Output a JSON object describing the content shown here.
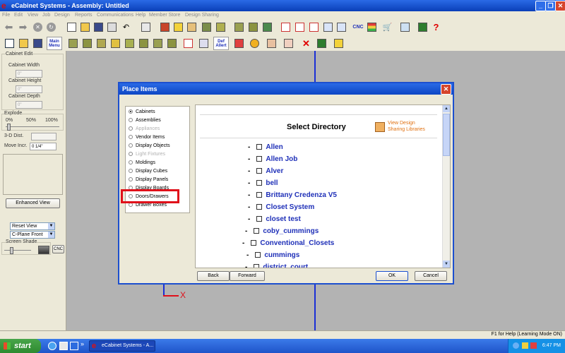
{
  "window": {
    "title": "eCabinet Systems - Assembly: Untitled",
    "minimize": "_",
    "maximize": "❐",
    "close": "✕"
  },
  "menu": [
    "File",
    "Edit",
    "View",
    "Job",
    "Design",
    "Reports",
    "Communications",
    "Help",
    "Member Store",
    "Design Sharing"
  ],
  "toolbar": {
    "main_label": "Main",
    "main_sublabel": "Menu",
    "cnc_label": "CNC",
    "help_glyph": "?",
    "def_label": "Def",
    "def_sublabel": "Allert"
  },
  "left_panel": {
    "section_title": "Cabinet Edit",
    "cabinet_width_label": "Cabinet Width",
    "cabinet_width_value": "0\"",
    "cabinet_height_label": "Cabinet Height",
    "cabinet_height_value": "0\"",
    "cabinet_depth_label": "Cabinet Depth",
    "cabinet_depth_value": "0\"",
    "explode_label": "Explode",
    "explode_ticks": [
      "0%",
      "50%",
      "100%"
    ],
    "dist_3d_label": "3-D Dist.",
    "move_incr_label": "Move Incr.",
    "move_incr_value": "0 1/4\"",
    "enhanced_view_button": "Enhanced View",
    "view_select": "Reset View",
    "plane_select": "C-Plane Front",
    "screen_shade_label": "Screen Shade",
    "cnc_button": "CNC"
  },
  "canvas": {
    "axis_x_label": "X"
  },
  "dialog": {
    "title": "Place Items",
    "close": "✕",
    "categories": [
      {
        "label": "Cabinets",
        "selected": true,
        "disabled": false
      },
      {
        "label": "Assemblies",
        "selected": false,
        "disabled": false
      },
      {
        "label": "Appliances",
        "selected": false,
        "disabled": true
      },
      {
        "label": "Vendor Items",
        "selected": false,
        "disabled": false
      },
      {
        "label": "Display Objects",
        "selected": false,
        "disabled": false
      },
      {
        "label": "Light Fixtures",
        "selected": false,
        "disabled": true
      },
      {
        "label": "Moldings",
        "selected": false,
        "disabled": false
      },
      {
        "label": "Display Cubes",
        "selected": false,
        "disabled": false
      },
      {
        "label": "Display Panels",
        "selected": false,
        "disabled": false
      },
      {
        "label": "Display Boards",
        "selected": false,
        "disabled": false
      },
      {
        "label": "Doors/Drawers",
        "selected": false,
        "disabled": false
      },
      {
        "label": "Drawer Boxes",
        "selected": false,
        "disabled": false
      }
    ],
    "heading": "Select Directory",
    "view_libraries_line1": "View Design",
    "view_libraries_line2": "Sharing Libraries",
    "directories": [
      {
        "name": "Allen",
        "indent": 0
      },
      {
        "name": "Allen Job",
        "indent": 0
      },
      {
        "name": "Alver",
        "indent": 0
      },
      {
        "name": "bell",
        "indent": 0
      },
      {
        "name": "Brittany Credenza V5",
        "indent": 0
      },
      {
        "name": "Closet System",
        "indent": 0
      },
      {
        "name": "closet test",
        "indent": 0
      },
      {
        "name": "coby_cummings",
        "indent": 1
      },
      {
        "name": "Conventional_Closets",
        "indent": 2
      },
      {
        "name": "cummings",
        "indent": 0
      },
      {
        "name": "district_court",
        "indent": 1
      }
    ],
    "back_button": "Back",
    "forward_button": "Forward",
    "ok_button": "OK",
    "cancel_button": "Cancel"
  },
  "status_bar": {
    "help_text": "F1 for Help (Learning Mode ON)"
  },
  "taskbar": {
    "start_label": "start",
    "task_label": "eCabinet Systems - A...",
    "clock": "6:47 PM"
  },
  "colors": {
    "highlight": "#e0101a",
    "directory_text": "#1f30b8",
    "title_blue": "#0a3fb8",
    "axis_red": "#e0101a",
    "axis_blue": "#1a2fd6"
  }
}
